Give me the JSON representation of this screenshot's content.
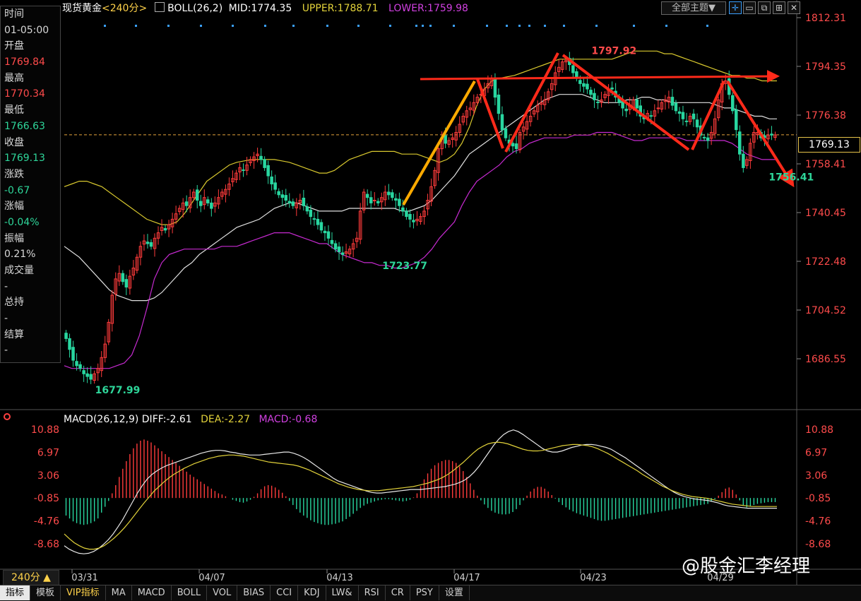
{
  "info_panel": [
    {
      "label": "时间",
      "value": "01-05:00",
      "tone": "plain"
    },
    {
      "label": "开盘",
      "value": "1769.84",
      "tone": "up"
    },
    {
      "label": "最高",
      "value": "1770.34",
      "tone": "up"
    },
    {
      "label": "最低",
      "value": "1766.63",
      "tone": "down"
    },
    {
      "label": "收盘",
      "value": "1769.13",
      "tone": "down"
    },
    {
      "label": "涨跌",
      "value": "-0.67",
      "tone": "down"
    },
    {
      "label": "涨幅",
      "value": "-0.04%",
      "tone": "down"
    },
    {
      "label": "振幅",
      "value": "0.21%",
      "tone": "plain"
    },
    {
      "label": "成交量",
      "value": "-",
      "tone": "plain"
    },
    {
      "label": "总持",
      "value": "-",
      "tone": "plain"
    },
    {
      "label": "结算",
      "value": "-",
      "tone": "plain"
    }
  ],
  "header": {
    "symbol": "现货黄金",
    "period_tag": "<240分>",
    "boll_label": "BOLL(26,2)",
    "mid": "MID:1774.35",
    "upper": "UPPER:1788.71",
    "lower": "LOWER:1759.98",
    "theme_button": "全部主题▼"
  },
  "macd_header": {
    "label": "MACD(26,12,9)",
    "diff": "DIFF:-2.61",
    "dea": "DEA:-2.27",
    "macd": "MACD:-0.68"
  },
  "current_price": "1769.13",
  "period_button": "240分 ▲",
  "watermark": "@股金汇李经理",
  "tabs": [
    "指标",
    "模板",
    "VIP指标",
    "MA",
    "MACD",
    "BOLL",
    "VOL",
    "BIAS",
    "CCI",
    "KDJ",
    "LW&",
    "RSI",
    "CR",
    "PSY",
    "设置"
  ],
  "colors": {
    "up": "#ff3b3b",
    "down": "#28d7a0",
    "boll_upper": "#d8c82e",
    "boll_mid": "#e0e0e0",
    "boll_lower": "#c62ad0",
    "arrow_red": "#ff2a1a",
    "arrow_orange": "#ffaa00"
  },
  "chart_data": {
    "type": "candlestick",
    "price_axis": [
      "1812.31",
      "1794.35",
      "1776.38",
      "1758.41",
      "1740.45",
      "1722.48",
      "1704.52",
      "1686.55"
    ],
    "ylim": [
      1680,
      1812.31
    ],
    "date_labels": [
      "03/31",
      "04/07",
      "04/13",
      "04/17",
      "04/23",
      "04/29"
    ],
    "annotations": [
      {
        "text": "1677.99",
        "value": 1677.99,
        "index": 7,
        "tone": "low"
      },
      {
        "text": "1723.77",
        "value": 1723.77,
        "index": 88,
        "tone": "low"
      },
      {
        "text": "1797.92",
        "value": 1797.92,
        "index": 147,
        "tone": "high"
      },
      {
        "text": "1756.41",
        "value": 1756.41,
        "index": 197,
        "tone": "low"
      }
    ],
    "candles_close": [
      1694,
      1690,
      1686,
      1684,
      1683,
      1681,
      1680,
      1679,
      1681,
      1683,
      1687,
      1692,
      1700,
      1710,
      1716,
      1718,
      1715,
      1713,
      1717,
      1720,
      1724,
      1728,
      1730,
      1729,
      1728,
      1731,
      1733,
      1735,
      1734,
      1736,
      1738,
      1740,
      1742,
      1744,
      1743,
      1746,
      1748,
      1745,
      1743,
      1746,
      1744,
      1742,
      1744,
      1746,
      1748,
      1749,
      1751,
      1753,
      1755,
      1757,
      1756,
      1758,
      1760,
      1761,
      1762,
      1760,
      1757,
      1754,
      1751,
      1749,
      1747,
      1746,
      1745,
      1744,
      1743,
      1744,
      1745,
      1743,
      1741,
      1739,
      1738,
      1736,
      1734,
      1733,
      1731,
      1729,
      1727,
      1726,
      1725,
      1726,
      1727,
      1729,
      1731,
      1741,
      1748,
      1746,
      1744,
      1745,
      1744,
      1746,
      1748,
      1747,
      1746,
      1745,
      1743,
      1741,
      1739,
      1738,
      1737,
      1738,
      1739,
      1741,
      1745,
      1750,
      1756,
      1764,
      1768,
      1766,
      1767,
      1768,
      1770,
      1773,
      1776,
      1778,
      1779,
      1781,
      1783,
      1784,
      1786,
      1788,
      1790,
      1783,
      1777,
      1771,
      1768,
      1766,
      1765,
      1764,
      1770,
      1772,
      1774,
      1776,
      1778,
      1780,
      1781,
      1782,
      1785,
      1788,
      1792,
      1794,
      1796,
      1796.5,
      1795,
      1792,
      1790,
      1788,
      1787,
      1786,
      1784,
      1782,
      1781,
      1782,
      1784,
      1786,
      1786,
      1783,
      1781,
      1779,
      1778,
      1780,
      1782,
      1779,
      1776,
      1775,
      1777,
      1776,
      1778,
      1779,
      1781,
      1782,
      1783,
      1780,
      1778,
      1777,
      1775,
      1774,
      1776,
      1775,
      1772,
      1769,
      1768,
      1767,
      1770,
      1775,
      1782,
      1788,
      1789,
      1784,
      1778,
      1771,
      1762,
      1757,
      1760,
      1766,
      1770,
      1770,
      1768,
      1768,
      1769,
      1769,
      1769.1
    ],
    "boll": {
      "upper": [
        1750,
        1751,
        1752,
        1752,
        1751,
        1750,
        1748,
        1746,
        1744,
        1742,
        1740,
        1738,
        1737,
        1736,
        1736,
        1737,
        1740,
        1744,
        1748,
        1752,
        1754,
        1756,
        1758,
        1759,
        1759.5,
        1760,
        1760,
        1760,
        1760,
        1759.5,
        1759,
        1758,
        1757,
        1756,
        1755,
        1755,
        1756,
        1758,
        1760,
        1761,
        1762,
        1763,
        1763,
        1763,
        1763,
        1762,
        1762,
        1762,
        1761,
        1760,
        1759,
        1760,
        1762,
        1766,
        1772,
        1780,
        1786,
        1789,
        1790,
        1790.5,
        1791,
        1792,
        1793,
        1794,
        1795,
        1796,
        1797,
        1797,
        1797,
        1797,
        1797,
        1797,
        1797,
        1797,
        1798,
        1799,
        1800,
        1800,
        1800,
        1800,
        1799,
        1799,
        1798,
        1797,
        1796,
        1795,
        1794,
        1793,
        1792,
        1791,
        1791,
        1790,
        1790,
        1789,
        1789,
        1789
      ],
      "mid": [
        1728,
        1726,
        1724,
        1721,
        1718,
        1715,
        1712,
        1710,
        1709,
        1708,
        1708,
        1708,
        1709,
        1711,
        1714,
        1717,
        1720,
        1722,
        1725,
        1727,
        1729,
        1731,
        1733,
        1735,
        1736,
        1737,
        1738,
        1740,
        1742,
        1743,
        1744,
        1744,
        1743,
        1742,
        1741,
        1741,
        1741,
        1741,
        1742,
        1742,
        1742,
        1742,
        1742,
        1742,
        1742,
        1741,
        1741,
        1742,
        1743,
        1745,
        1748,
        1751,
        1754,
        1758,
        1762,
        1764,
        1766,
        1768,
        1770,
        1772,
        1774,
        1776,
        1778,
        1780,
        1782,
        1783,
        1784,
        1784,
        1784,
        1784,
        1783,
        1782,
        1781,
        1781,
        1781,
        1782,
        1782,
        1783,
        1783,
        1782,
        1782,
        1781,
        1781,
        1781,
        1781,
        1781,
        1781,
        1780,
        1779,
        1779,
        1778,
        1777,
        1776,
        1776,
        1775,
        1775
      ],
      "lower": [
        1684,
        1683,
        1683,
        1683,
        1683,
        1683,
        1683,
        1684,
        1685,
        1688,
        1695,
        1705,
        1716,
        1722,
        1725,
        1726,
        1727,
        1727,
        1727,
        1727,
        1727,
        1728,
        1728,
        1728,
        1729,
        1730,
        1731,
        1732,
        1733,
        1733,
        1733,
        1732,
        1731,
        1730,
        1729,
        1729,
        1727,
        1725,
        1724,
        1723,
        1722,
        1722,
        1721,
        1721,
        1720,
        1720,
        1721,
        1722,
        1724,
        1727,
        1731,
        1734,
        1737,
        1743,
        1748,
        1752,
        1754,
        1756,
        1758,
        1761,
        1763,
        1764,
        1766,
        1767,
        1768,
        1768,
        1768,
        1768,
        1769,
        1769,
        1769,
        1770,
        1770,
        1770,
        1769,
        1768,
        1767,
        1767,
        1768,
        1768,
        1768,
        1768,
        1768,
        1767,
        1767,
        1767,
        1767,
        1767,
        1767,
        1766,
        1764,
        1762,
        1761,
        1760,
        1760,
        1760
      ]
    },
    "macd": {
      "ylim": [
        -10.5,
        12.5
      ],
      "axis": [
        "10.88",
        "6.97",
        "3.06",
        "-0.85",
        "-4.76",
        "-8.68"
      ],
      "hist": [
        -3,
        -3.5,
        -4,
        -4.3,
        -4.5,
        -4.6,
        -4.5,
        -4.3,
        -4,
        -3.5,
        -2.5,
        -1.5,
        -0.5,
        0.8,
        2.2,
        3.6,
        5,
        6.3,
        7.5,
        8.5,
        9.3,
        9.8,
        10,
        9.8,
        9.5,
        9.0,
        8.5,
        8,
        7.5,
        7,
        6.5,
        6,
        5.5,
        5,
        4.5,
        4,
        3.6,
        3.2,
        2.8,
        2.4,
        2,
        1.6,
        1.2,
        0.8,
        0.6,
        0.3,
        0,
        -0.3,
        -0.5,
        -0.7,
        -0.8,
        -0.6,
        -0.3,
        0.2,
        0.8,
        1.5,
        2,
        2.2,
        2.1,
        1.8,
        1.4,
        0.9,
        0.3,
        -0.5,
        -1.2,
        -1.9,
        -2.5,
        -3,
        -3.4,
        -3.8,
        -4.1,
        -4.3,
        -4.5,
        -4.6,
        -4.6,
        -4.5,
        -4.4,
        -4.2,
        -4,
        -3.6,
        -3.2,
        -2.7,
        -2.2,
        -1.7,
        -1.3,
        -1.0,
        -0.8,
        -0.6,
        -0.4,
        -0.3,
        -0.2,
        -0.2,
        -0.3,
        -0.4,
        -0.5,
        -0.6,
        -0.5,
        -0.3,
        0.1,
        0.8,
        2,
        3.2,
        4.2,
        5,
        5.6,
        6,
        6.3,
        6.5,
        6.5,
        6.3,
        6,
        5.4,
        4.6,
        3.6,
        2.5,
        1.4,
        0.4,
        -0.4,
        -1.1,
        -1.7,
        -2.2,
        -2.5,
        -2.7,
        -2.8,
        -2.8,
        -2.7,
        -2.4,
        -1.9,
        -1.2,
        -0.4,
        0.4,
        1.1,
        1.6,
        1.9,
        1.9,
        1.6,
        1.1,
        0.5,
        -0.1,
        -0.7,
        -1.2,
        -1.6,
        -2,
        -2.3,
        -2.6,
        -2.8,
        -3,
        -3.2,
        -3.4,
        -3.6,
        -3.8,
        -3.9,
        -3.9,
        -3.8,
        -3.7,
        -3.6,
        -3.5,
        -3.4,
        -3.3,
        -3.2,
        -3.1,
        -3,
        -2.9,
        -2.8,
        -2.7,
        -2.6,
        -2.5,
        -2.4,
        -2.3,
        -2.2,
        -2.1,
        -2.0,
        -1.9,
        -1.8,
        -1.7,
        -1.6,
        -1.5,
        -1.4,
        -1.3,
        -1.2,
        -1.1,
        -1.0,
        -0.6,
        -0.2,
        0.4,
        1.0,
        1.6,
        1.8,
        1.4,
        0.6,
        -0.4,
        -1.2,
        -1.6,
        -1.4,
        -1.2,
        -1.0,
        -0.9,
        -0.8,
        -0.7,
        -0.7,
        -0.7
      ],
      "diff": [
        -9,
        -9.6,
        -10,
        -10.3,
        -10.4,
        -10.3,
        -10.0,
        -9.5,
        -8.8,
        -8,
        -7,
        -5.8,
        -4.5,
        -3.0,
        -1.5,
        0,
        1.3,
        2.4,
        3.2,
        3.8,
        4.3,
        4.7,
        5,
        5.3,
        5.6,
        5.9,
        6.2,
        6.5,
        6.8,
        7,
        7.2,
        7.3,
        7.3,
        7.2,
        7.0,
        6.9,
        6.7,
        6.6,
        6.5,
        6.5,
        6.5,
        6.6,
        6.7,
        6.8,
        6.9,
        7.0,
        7.0,
        6.8,
        6.5,
        6.1,
        5.6,
        5.0,
        4.4,
        3.8,
        3.2,
        2.6,
        2.1,
        1.8,
        1.5,
        1.2,
        0.9,
        0.6,
        0.3,
        0.1,
        0,
        0,
        0.1,
        0.2,
        0.3,
        0.4,
        0.5,
        0.6,
        0.6,
        0.6,
        0.7,
        0.8,
        0.9,
        1.0,
        1.1,
        1.3,
        1.5,
        1.8,
        2.2,
        2.8,
        3.6,
        4.6,
        5.8,
        7,
        8.2,
        9.2,
        10,
        10.5,
        10.8,
        10.5,
        10,
        9.4,
        8.8,
        8.2,
        7.6,
        7.2,
        7.0,
        7.0,
        7.2,
        7.5,
        7.8,
        8.0,
        8.2,
        8.3,
        8.3,
        8.2,
        8.0,
        7.8,
        7.5,
        7.0,
        6.5,
        6.0,
        5.4,
        4.8,
        4.2,
        3.6,
        3.0,
        2.4,
        1.8,
        1.2,
        0.6,
        0.1,
        -0.3,
        -0.6,
        -0.8,
        -1.0,
        -1.1,
        -1.2,
        -1.3,
        -1.5,
        -1.7,
        -2,
        -2.2,
        -2.3,
        -2.4,
        -2.5,
        -2.6,
        -2.6,
        -2.6,
        -2.6,
        -2.6,
        -2.6,
        -2.6
      ],
      "dea": [
        -7,
        -7.8,
        -8.5,
        -9.0,
        -9.4,
        -9.6,
        -9.6,
        -9.4,
        -9.0,
        -8.4,
        -7.7,
        -6.9,
        -6.0,
        -5.0,
        -3.9,
        -2.8,
        -1.7,
        -0.7,
        0.3,
        1.1,
        1.9,
        2.6,
        3.2,
        3.7,
        4.2,
        4.6,
        5.0,
        5.3,
        5.6,
        5.9,
        6.1,
        6.3,
        6.4,
        6.5,
        6.5,
        6.4,
        6.3,
        6.1,
        5.9,
        5.7,
        5.5,
        5.3,
        5.2,
        5.1,
        5.0,
        4.9,
        4.8,
        4.6,
        4.3,
        4.0,
        3.6,
        3.2,
        2.8,
        2.4,
        2.0,
        1.6,
        1.3,
        1.0,
        0.8,
        0.6,
        0.5,
        0.4,
        0.4,
        0.4,
        0.5,
        0.6,
        0.7,
        0.8,
        0.9,
        1.0,
        1.1,
        1.3,
        1.5,
        1.7,
        2.0,
        2.3,
        2.7,
        3.2,
        3.8,
        4.5,
        5.2,
        6.0,
        6.8,
        7.5,
        8.0,
        8.4,
        8.6,
        8.7,
        8.6,
        8.4,
        8.1,
        7.8,
        7.5,
        7.3,
        7.2,
        7.2,
        7.3,
        7.5,
        7.7,
        7.9,
        8.1,
        8.2,
        8.3,
        8.3,
        8.2,
        8.1,
        7.9,
        7.6,
        7.2,
        6.8,
        6.3,
        5.8,
        5.3,
        4.8,
        4.3,
        3.8,
        3.2,
        2.7,
        2.2,
        1.7,
        1.2,
        0.8,
        0.4,
        0.1,
        -0.2,
        -0.4,
        -0.6,
        -0.7,
        -0.8,
        -0.9,
        -1.1,
        -1.3,
        -1.5,
        -1.7,
        -1.9,
        -2.0,
        -2.1,
        -2.2,
        -2.3,
        -2.3,
        -2.3,
        -2.3,
        -2.3,
        -2.3
      ]
    }
  }
}
